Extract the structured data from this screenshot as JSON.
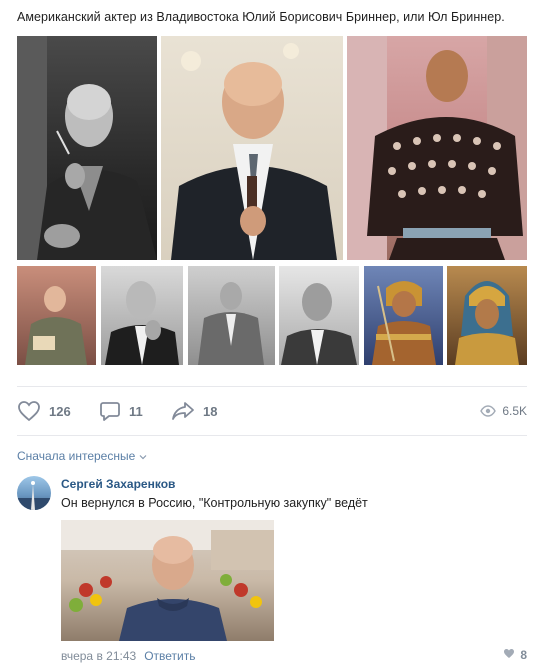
{
  "post": {
    "text": "Американский актер из Владивостока Юлий Борисович Бриннер, или Юл Бриннер."
  },
  "actions": {
    "likes": "126",
    "comments": "11",
    "shares": "18",
    "views": "6.5K"
  },
  "comments_section": {
    "sort_label": "Сначала интересные"
  },
  "comment": {
    "author": "Сергей Захаренков",
    "text": "Он вернулся в Россию, \"Контрольную закупку\" ведёт",
    "time": "вчера в 21:43",
    "reply_label": "Ответить",
    "likes": "8"
  },
  "icons": {
    "like": "heart-icon",
    "comment": "comment-icon",
    "share": "share-arrow-icon",
    "views": "eye-icon",
    "sort": "chevron-down-icon"
  },
  "colors": {
    "link": "#2a5885",
    "muted": "#818c99",
    "action": "#6f7985",
    "divider": "#e7e8ec"
  }
}
